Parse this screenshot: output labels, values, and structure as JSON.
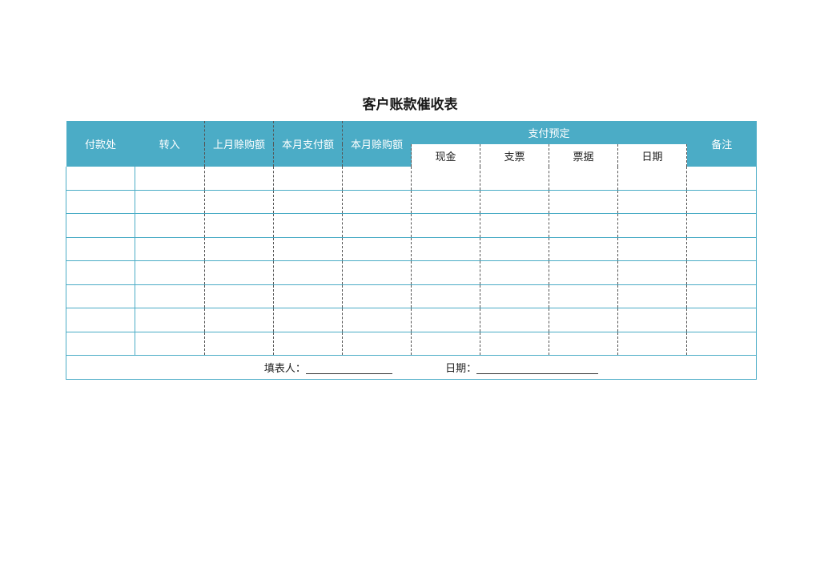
{
  "title": "客户账款催收表",
  "headers": {
    "payer": "付款处",
    "transfer_in": "转入",
    "last_month_credit": "上月赊购额",
    "this_month_paid": "本月支付额",
    "this_month_credit": "本月赊购额",
    "payment_plan": "支付预定",
    "cash": "现金",
    "check": "支票",
    "bill": "票据",
    "date": "日期",
    "remarks": "备注"
  },
  "footer": {
    "filler_label": "填表人：",
    "date_label": "日期："
  },
  "colors": {
    "header_bg": "#4bacc6",
    "header_text": "#ffffff",
    "grid_line": "#4bacc6"
  }
}
